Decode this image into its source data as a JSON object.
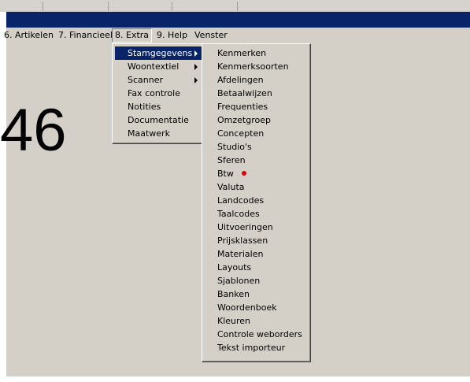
{
  "menubar": {
    "items": [
      "6. Artikelen",
      "7. Financieel",
      "8. Extra",
      "9. Help",
      "Venster"
    ]
  },
  "big_number": "46",
  "extra_menu": {
    "items": [
      {
        "label": "Stamgegevens",
        "submenu": true
      },
      {
        "label": "Woontextiel",
        "submenu": true
      },
      {
        "label": "Scanner",
        "submenu": true
      },
      {
        "label": "Fax controle",
        "submenu": false
      },
      {
        "label": "Notities",
        "submenu": false
      },
      {
        "label": "Documentatie",
        "submenu": false
      },
      {
        "label": "Maatwerk",
        "submenu": false
      }
    ]
  },
  "stamgegevens_menu": {
    "items": [
      "Kenmerken",
      "Kenmerksoorten",
      "Afdelingen",
      "Betaalwijzen",
      "Frequenties",
      "Omzetgroep",
      "Concepten",
      "Studio's",
      "Sferen",
      "Btw",
      "Valuta",
      "Landcodes",
      "Taalcodes",
      "Uitvoeringen",
      "Prijsklassen",
      "Materialen",
      "Layouts",
      "Sjablonen",
      "Banken",
      "Woordenboek",
      "Kleuren",
      "Controle weborders",
      "Tekst importeur"
    ]
  },
  "colors": {
    "highlight": "#0a246a",
    "marker": "#e00000",
    "face": "#d4d0c8"
  }
}
